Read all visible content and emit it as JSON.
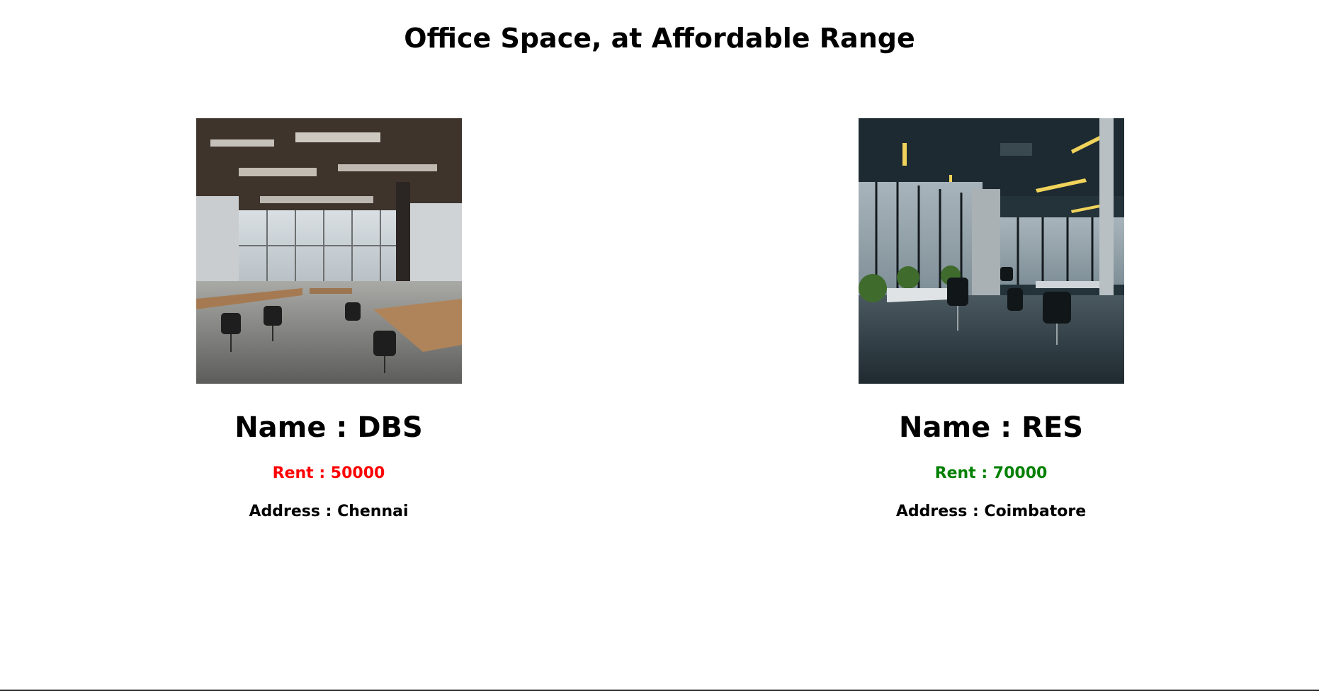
{
  "header": {
    "title": "Office Space, at Affordable Range"
  },
  "offices": [
    {
      "name_text": "Name : DBS",
      "rent_text": "Rent : 50000",
      "rent_color": "#ff0000",
      "address_text": "Address : Chennai",
      "image_icon": "office-interior-bright-image"
    },
    {
      "name_text": "Name : RES",
      "rent_text": "Rent : 70000",
      "rent_color": "#008000",
      "address_text": "Address : Coimbatore",
      "image_icon": "office-interior-dark-image"
    }
  ]
}
